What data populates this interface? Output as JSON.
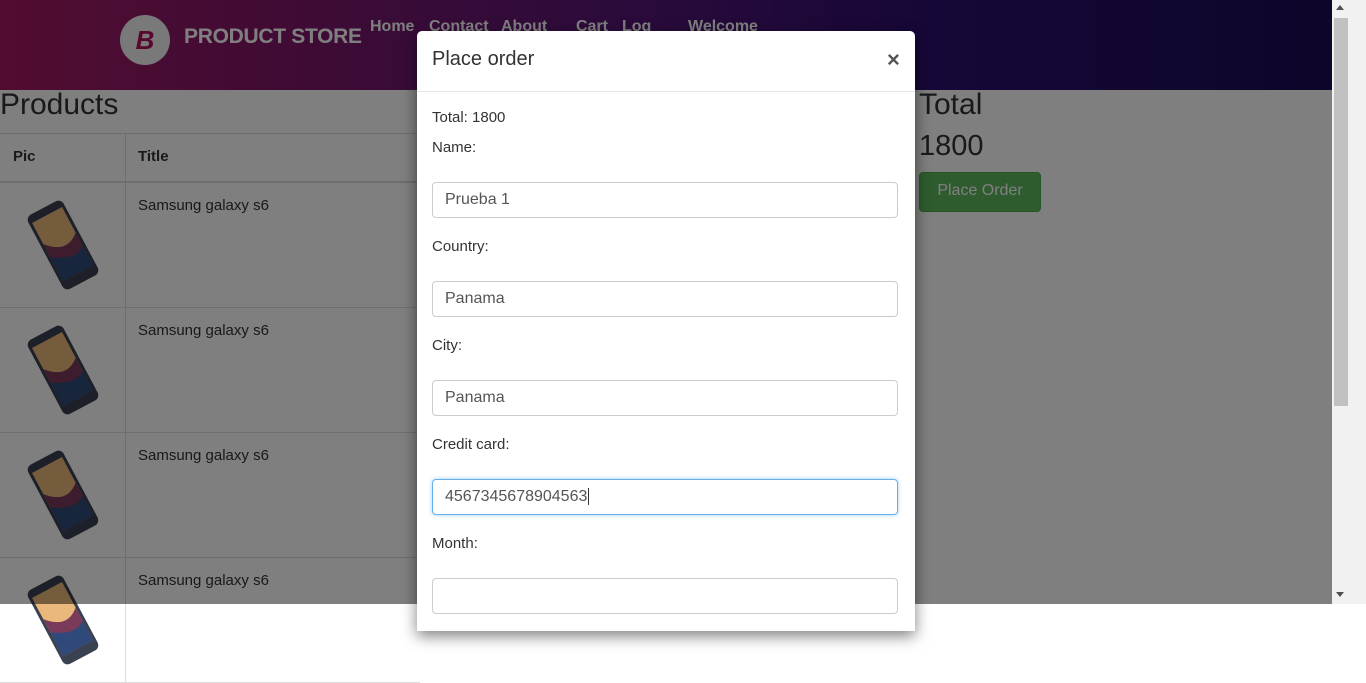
{
  "navbar": {
    "brand_logo": "B",
    "brand_text": "PRODUCT STORE",
    "links": [
      "Home",
      "Contact",
      "About",
      "Cart",
      "Log",
      "Welcome"
    ]
  },
  "products": {
    "heading": "Products",
    "columns": [
      "Pic",
      "Title"
    ],
    "rows": [
      {
        "title": "Samsung galaxy s6"
      },
      {
        "title": "Samsung galaxy s6"
      },
      {
        "title": "Samsung galaxy s6"
      },
      {
        "title": "Samsung galaxy s6"
      }
    ]
  },
  "total": {
    "heading": "Total",
    "value": "1800",
    "button": "Place Order"
  },
  "modal": {
    "title": "Place order",
    "close": "×",
    "total_line": "Total: 1800",
    "fields": {
      "name": {
        "label": "Name:",
        "value": "Prueba 1"
      },
      "country": {
        "label": "Country:",
        "value": "Panama"
      },
      "city": {
        "label": "City:",
        "value": "Panama"
      },
      "card": {
        "label": "Credit card:",
        "value": "4567345678904563"
      },
      "month": {
        "label": "Month:",
        "value": ""
      }
    }
  },
  "colors": {
    "place_order_button": "#5cb85c",
    "focus_border": "#66afe9"
  }
}
